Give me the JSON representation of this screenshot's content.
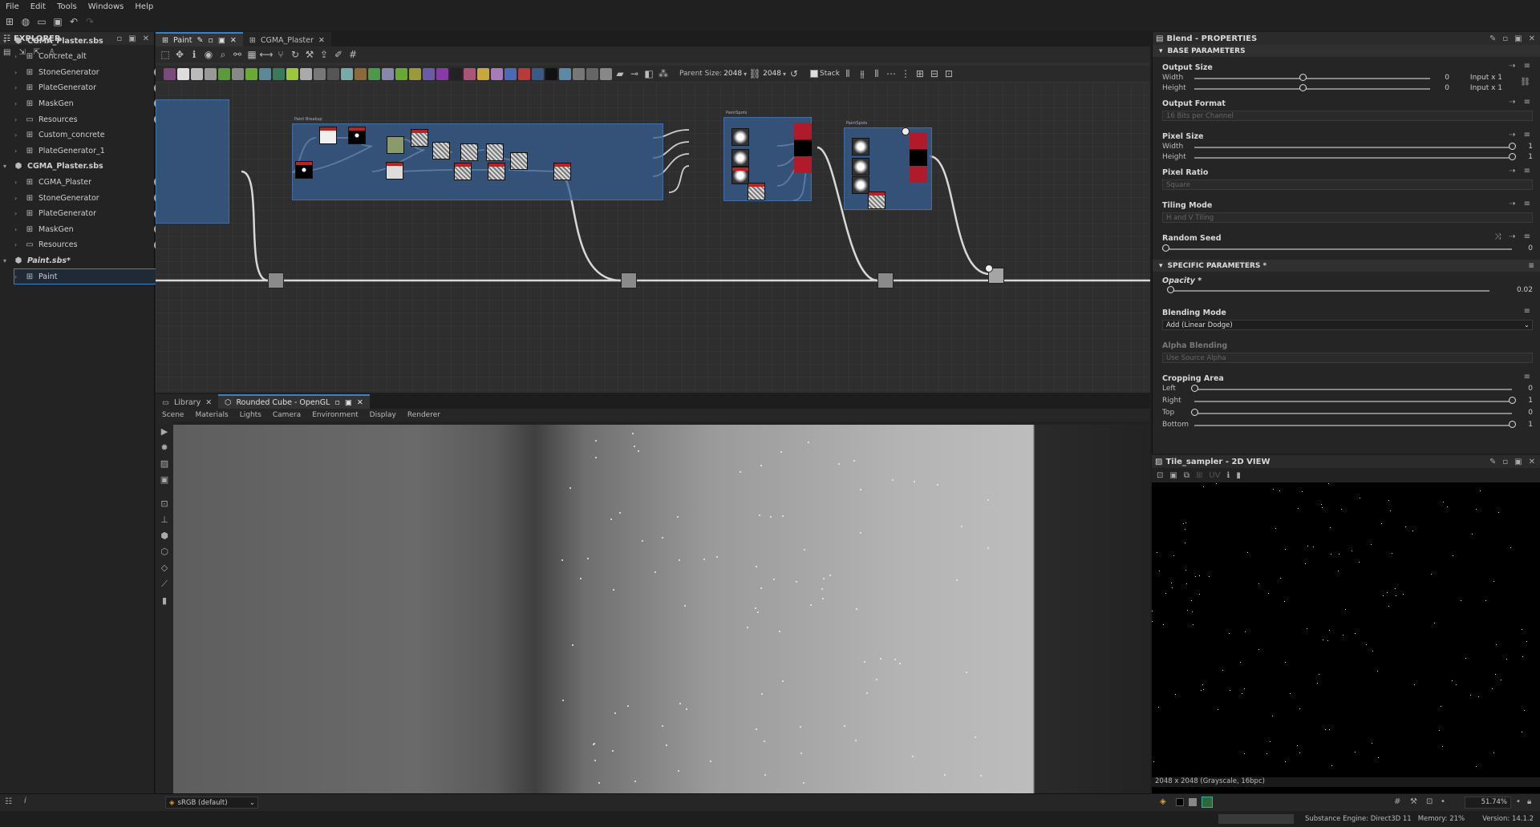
{
  "menu": [
    "File",
    "Edit",
    "Tools",
    "Windows",
    "Help"
  ],
  "explorer": {
    "title": "EXPLORER",
    "items": [
      {
        "label": "CGMA_Plaster.sbs",
        "level": 0,
        "bold": true,
        "icon": "package-icon"
      },
      {
        "label": "Concrete_alt",
        "level": 1,
        "icon": "graph-icon",
        "info": false
      },
      {
        "label": "StoneGenerator",
        "level": 1,
        "icon": "graph-icon",
        "info": true
      },
      {
        "label": "PlateGenerator",
        "level": 1,
        "icon": "graph-icon",
        "info": true
      },
      {
        "label": "MaskGen",
        "level": 1,
        "icon": "graph-icon",
        "info": true
      },
      {
        "label": "Resources",
        "level": 1,
        "icon": "folder-icon",
        "info": true
      },
      {
        "label": "Custom_concrete",
        "level": 1,
        "icon": "graph-icon",
        "info": false
      },
      {
        "label": "PlateGenerator_1",
        "level": 1,
        "icon": "graph-icon",
        "info": false
      },
      {
        "label": "CGMA_Plaster.sbs",
        "level": 0,
        "bold": true,
        "icon": "package-icon"
      },
      {
        "label": "CGMA_Plaster",
        "level": 1,
        "icon": "graph-icon",
        "info": true
      },
      {
        "label": "StoneGenerator",
        "level": 1,
        "icon": "graph-icon",
        "info": true
      },
      {
        "label": "PlateGenerator",
        "level": 1,
        "icon": "graph-icon",
        "info": true
      },
      {
        "label": "MaskGen",
        "level": 1,
        "icon": "graph-icon",
        "info": true
      },
      {
        "label": "Resources",
        "level": 1,
        "icon": "folder-icon",
        "info": true
      },
      {
        "label": "Paint.sbs*",
        "level": 0,
        "bold": true,
        "italic": true,
        "icon": "package-icon"
      },
      {
        "label": "Paint",
        "level": 1,
        "icon": "graph-icon",
        "info": false,
        "selected": true
      }
    ]
  },
  "graph": {
    "tabs": [
      {
        "label": "Paint",
        "active": true
      },
      {
        "label": "CGMA_Plaster",
        "active": false
      }
    ],
    "parent_size_label": "Parent Size:",
    "parent_size_value": "2048",
    "size_value": "2048",
    "stack_label": "Stack",
    "frames": [
      "Paint Breakup",
      "PaintSpots",
      "PaintSpots"
    ]
  },
  "viewport": {
    "tabs": [
      {
        "label": "Library",
        "active": false
      },
      {
        "label": "Rounded Cube - OpenGL",
        "active": true
      }
    ],
    "menu": [
      "Scene",
      "Materials",
      "Lights",
      "Camera",
      "Environment",
      "Display",
      "Renderer"
    ],
    "colorspace": "sRGB (default)"
  },
  "properties": {
    "title": "Blend - PROPERTIES",
    "base_header": "BASE PARAMETERS",
    "output_size": {
      "label": "Output Size",
      "width_label": "Width",
      "height_label": "Height",
      "width_val": "0",
      "height_val": "0",
      "width_mode": "Input x 1",
      "height_mode": "Input x 1"
    },
    "output_format": {
      "label": "Output Format",
      "value": "16 Bits per Channel"
    },
    "pixel_size": {
      "label": "Pixel Size",
      "width_label": "Width",
      "height_label": "Height",
      "width_val": "1",
      "height_val": "1"
    },
    "pixel_ratio": {
      "label": "Pixel Ratio",
      "value": "Square"
    },
    "tiling_mode": {
      "label": "Tiling Mode",
      "value": "H and V Tiling"
    },
    "random_seed": {
      "label": "Random Seed",
      "value": "0"
    },
    "specific_header": "SPECIFIC PARAMETERS *",
    "opacity": {
      "label": "Opacity *",
      "value": "0.02"
    },
    "blending_mode": {
      "label": "Blending Mode",
      "value": "Add (Linear Dodge)"
    },
    "alpha_blending": {
      "label": "Alpha Blending",
      "value": "Use Source Alpha"
    },
    "cropping": {
      "label": "Cropping Area",
      "left_label": "Left",
      "right_label": "Right",
      "top_label": "Top",
      "bottom_label": "Bottom",
      "left_val": "0",
      "right_val": "1",
      "top_val": "0",
      "bottom_val": "1"
    }
  },
  "view2d": {
    "title": "Tile_sampler - 2D VIEW",
    "status": "2048 x 2048 (Grayscale, 16bpc)",
    "zoom": "51.74%",
    "uv_label": "UV"
  },
  "statusbar": {
    "engine": "Substance Engine: Direct3D 11",
    "memory": "Memory: 21%",
    "version": "Version: 14.1.2"
  }
}
